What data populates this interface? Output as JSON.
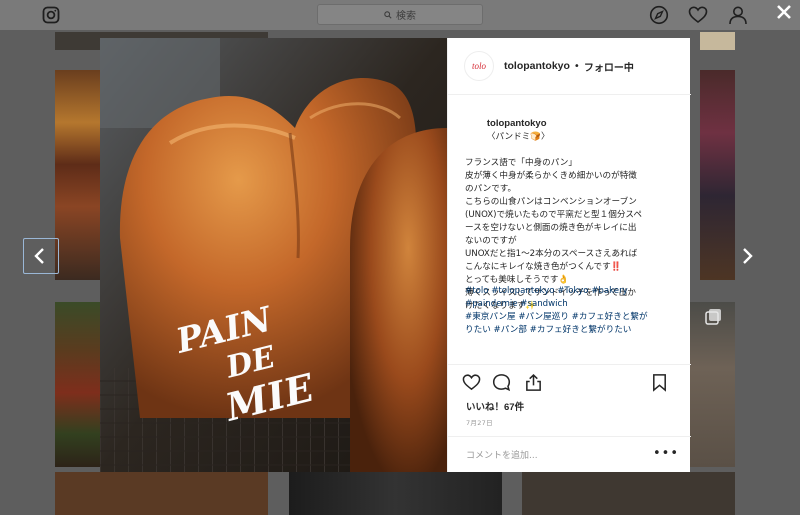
{
  "topbar": {
    "search_placeholder": "検索",
    "icons": [
      "instagram-icon",
      "search-icon",
      "explore-compass-icon",
      "heart-icon",
      "profile-icon",
      "close-icon"
    ]
  },
  "post": {
    "header": {
      "avatar_text": "tolo",
      "username": "tolopantokyo",
      "separator": "•",
      "follow_status": "フォロー中"
    },
    "image": {
      "subject": "bread",
      "overlay_text": [
        "PAIN",
        "DE",
        "MIE"
      ]
    },
    "caption": {
      "username": "tolopantokyo",
      "title": "〈パンドミ🍞〉",
      "lines": [
        "フランス語で「中身のパン」",
        "皮が薄く中身が柔らかくきめ細かいのが特徴",
        "のパンです。",
        "こちらの山食パンはコンベンションオーブン",
        "(UNOX)で焼いたもので平窯だと型１個分スペ",
        "ースを空けないと側面の焼き色がキレイに出",
        "ないのですが",
        "UNOXだと指1〜2本分のスペースさえあれば",
        "こんなにキレイな焼き色がつくんです‼️",
        "とっても美味しそうです👌",
        "薄くスライスしてサンドイッチを作って出か",
        "けたくなります✨"
      ]
    },
    "hashtags": [
      "#tolo #tolopantokyo #Tokyo #bakery",
      "#paindemie #sandwich",
      "#東京パン屋 #パン屋巡り #カフェ好きと繋が",
      "りたい #パン部 #カフェ好きと繋がりたい"
    ],
    "likes": "いいね！67件",
    "date": "7月27日",
    "comment_placeholder": "コメントを追加...",
    "more_label": "•••",
    "action_icons": [
      "heart-icon",
      "comment-icon",
      "share-icon",
      "bookmark-icon"
    ]
  },
  "colors": {
    "accent_link": "#003569",
    "overlay": "#5e5e5e",
    "brand_red": "#d52b35"
  }
}
